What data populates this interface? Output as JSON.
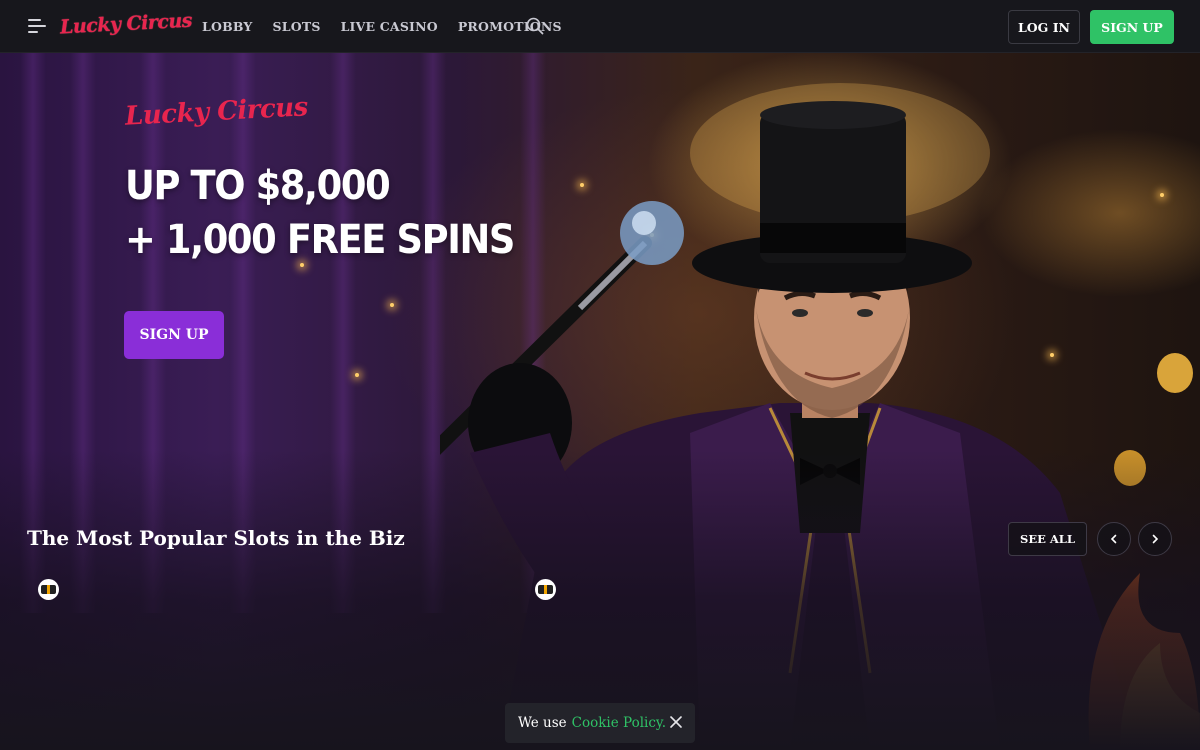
{
  "header": {
    "brand": "Lucky Circus",
    "nav": [
      "LOBBY",
      "SLOTS",
      "LIVE CASINO",
      "PROMOTIONS"
    ],
    "login_label": "LOG IN",
    "signup_label": "SIGN UP"
  },
  "hero": {
    "brand": "Lucky Circus",
    "promo_line_1": "UP TO $8,000",
    "promo_line_2": "+ 1,000 FREE SPINS",
    "signup_label": "SIGN UP"
  },
  "popular_slots": {
    "title": "The Most Popular Slots in the Biz",
    "see_all_label": "SEE ALL"
  },
  "cookie_bar": {
    "text": "We use",
    "link": "Cookie Policy."
  },
  "colors": {
    "brand_red": "#e8254e",
    "signup_green": "#2fc266",
    "hero_button_purple": "#8a2ed8",
    "header_bg": "#17171c"
  },
  "icons": [
    "hamburger-menu-icon",
    "search-icon",
    "chevron-left-icon",
    "chevron-right-icon",
    "close-icon"
  ]
}
